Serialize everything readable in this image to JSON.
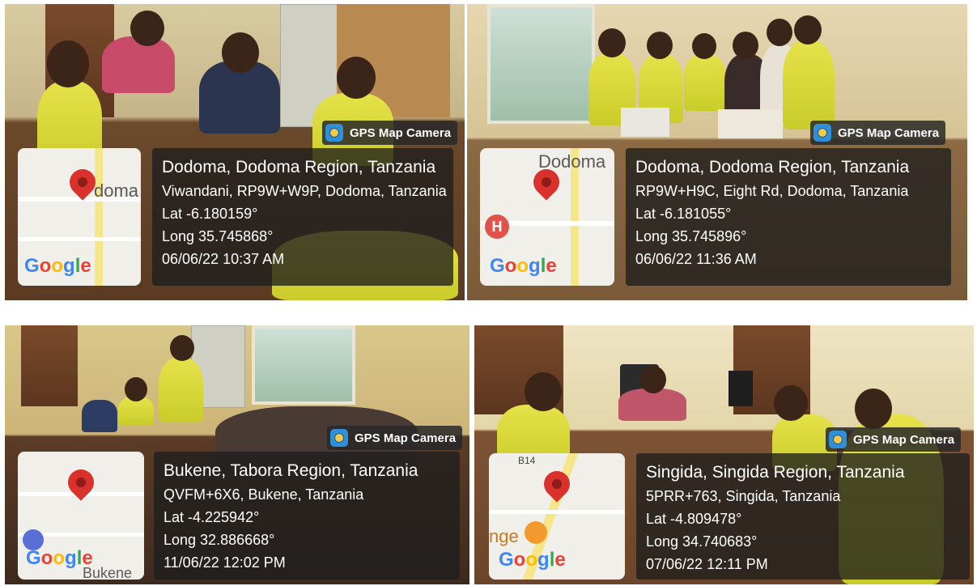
{
  "badge_label": "GPS Map Camera",
  "google_logo": {
    "parts": [
      "G",
      "o",
      "o",
      "g",
      "l",
      "e"
    ]
  },
  "photos": [
    {
      "title": "Dodoma, Dodoma Region, Tanzania",
      "address": "Viwandani, RP9W+W9P, Dodoma, Tanzania",
      "lat": "Lat -6.180159°",
      "long": "Long 35.745868°",
      "datetime": "06/06/22 10:37 AM",
      "map_place_label": "doma"
    },
    {
      "title": "Dodoma, Dodoma Region, Tanzania",
      "address": "RP9W+H9C, Eight Rd, Dodoma, Tanzania",
      "lat": "Lat -6.181055°",
      "long": "Long 35.745896°",
      "datetime": "06/06/22 11:36 AM",
      "map_place_label": "Dodoma"
    },
    {
      "title": "Bukene, Tabora Region, Tanzania",
      "address": "QVFM+6X6, Bukene, Tanzania",
      "lat": "Lat -4.225942°",
      "long": "Long 32.886668°",
      "datetime": "11/06/22 12:02 PM",
      "map_place_label": "Bukene S"
    },
    {
      "title": "Singida, Singida Region, Tanzania",
      "address": "5PRR+763, Singida, Tanzania",
      "lat": "Lat -4.809478°",
      "long": "Long 34.740683°",
      "datetime": "07/06/22 12:11 PM",
      "map_place_label": "nge",
      "map_road_label": "B14"
    }
  ]
}
